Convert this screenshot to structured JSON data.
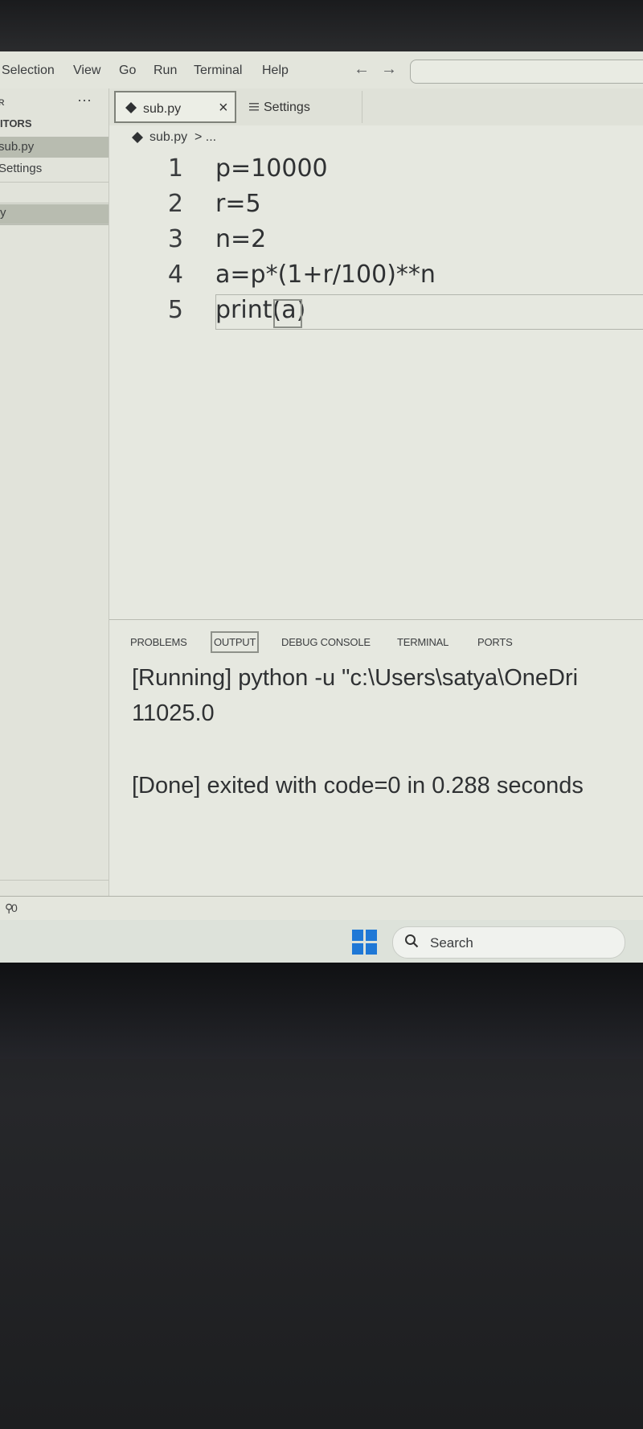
{
  "menu": {
    "items": [
      "Selection",
      "View",
      "Go",
      "Run",
      "Terminal",
      "Help"
    ],
    "back_arrow": "←",
    "forward_arrow": "→"
  },
  "sidebar": {
    "more": "···",
    "section_header": "ITORS",
    "open_editors": [
      "sub.py",
      "Settings"
    ],
    "explorer_item": "y",
    "status_count": "0"
  },
  "tabs": [
    {
      "label": "sub.py",
      "close": "×"
    },
    {
      "label": "Settings"
    }
  ],
  "breadcrumb": {
    "file": "sub.py",
    "rest": "> ..."
  },
  "editor": {
    "lines": [
      {
        "number": "1",
        "code": "p=10000"
      },
      {
        "number": "2",
        "code": "r=5"
      },
      {
        "number": "3",
        "code": "n=2"
      },
      {
        "number": "4",
        "code": "a=p*(1+r/100)**n"
      },
      {
        "number": "5",
        "code": "print(a)"
      }
    ]
  },
  "panel": {
    "tabs": [
      "PROBLEMS",
      "OUTPUT",
      "DEBUG CONSOLE",
      "TERMINAL",
      "PORTS"
    ],
    "active_tab": "OUTPUT",
    "output": [
      "[Running] python -u \"c:\\Users\\satya\\OneDri",
      "11025.0",
      "[Done] exited with code=0 in 0.288 seconds"
    ]
  },
  "taskbar": {
    "search_label": "Search"
  },
  "colors": {
    "accent_windows": "#1f78d6",
    "background": "#e6e8e0"
  }
}
